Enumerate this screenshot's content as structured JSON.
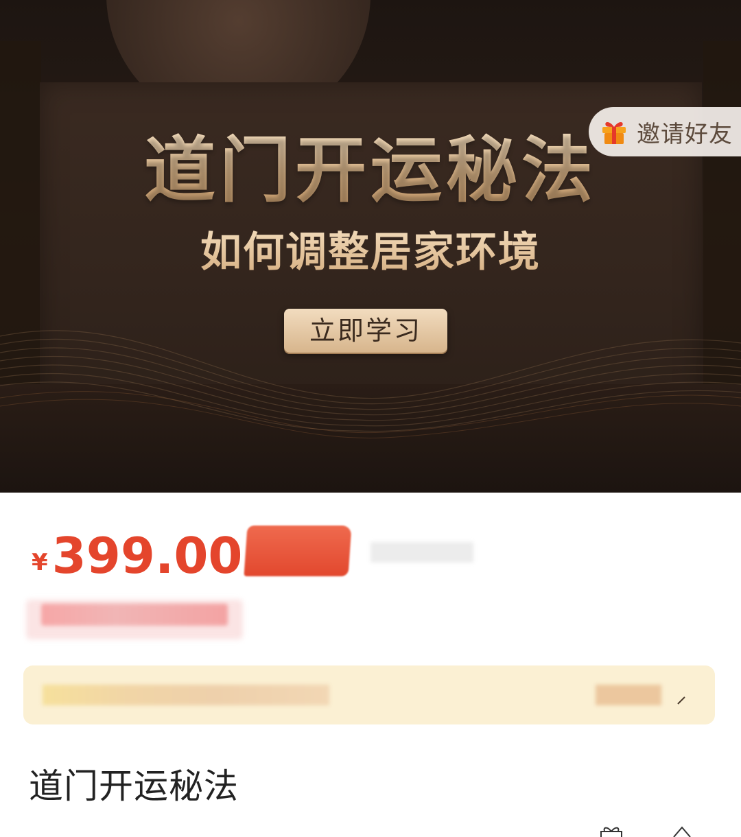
{
  "banner": {
    "title": "道门开运秘法",
    "subtitle": "如何调整居家环境",
    "cta_label": "立即学习",
    "invite_label": "邀请好友",
    "invite_icon": "gift-icon"
  },
  "price": {
    "currency": "¥",
    "amount": "399.00",
    "color": "#e4452c"
  },
  "product": {
    "title": "道门开运秘法"
  },
  "promo": {
    "chevron_icon": "chevron-right-icon"
  }
}
